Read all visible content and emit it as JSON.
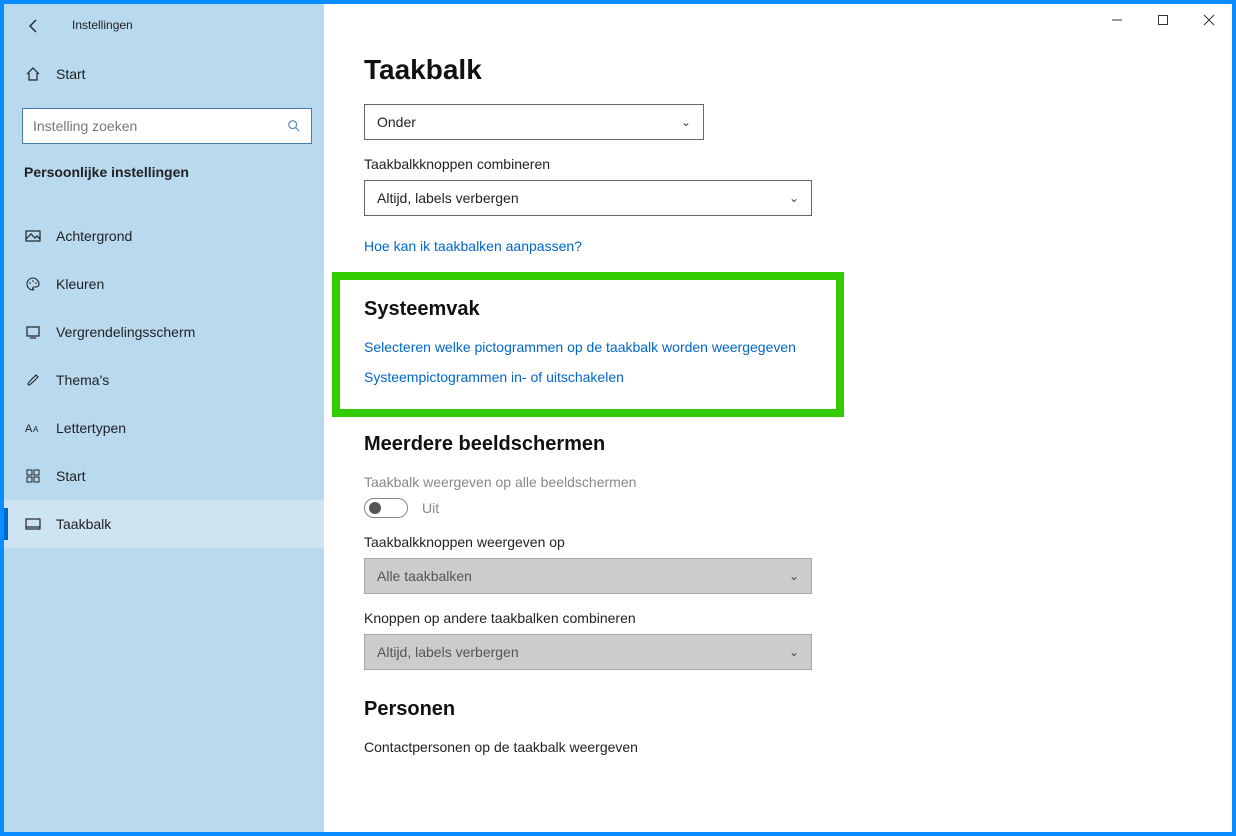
{
  "window": {
    "title": "Instellingen"
  },
  "sidebar": {
    "home": "Start",
    "searchPlaceholder": "Instelling zoeken",
    "category": "Persoonlijke instellingen",
    "items": [
      {
        "label": "Achtergrond"
      },
      {
        "label": "Kleuren"
      },
      {
        "label": "Vergrendelingsscherm"
      },
      {
        "label": "Thema's"
      },
      {
        "label": "Lettertypen"
      },
      {
        "label": "Start"
      },
      {
        "label": "Taakbalk"
      }
    ]
  },
  "main": {
    "pageTitle": "Taakbalk",
    "positionDropdown": "Onder",
    "combineLabel": "Taakbalkknoppen combineren",
    "combineDropdown": "Altijd, labels verbergen",
    "helpLink": "Hoe kan ik taakbalken aanpassen?",
    "systray": {
      "title": "Systeemvak",
      "link1": "Selecteren welke pictogrammen op de taakbalk worden weergegeven",
      "link2": "Systeempictogrammen in- of uitschakelen"
    },
    "multiMon": {
      "title": "Meerdere beeldschermen",
      "showAllLabel": "Taakbalk weergeven op alle beeldschermen",
      "toggleState": "Uit",
      "showButtonsLabel": "Taakbalkknoppen weergeven op",
      "showButtonsDropdown": "Alle taakbalken",
      "combineOtherLabel": "Knoppen op andere taakbalken combineren",
      "combineOtherDropdown": "Altijd, labels verbergen"
    },
    "people": {
      "title": "Personen",
      "showContactsLabel": "Contactpersonen op de taakbalk weergeven"
    }
  }
}
